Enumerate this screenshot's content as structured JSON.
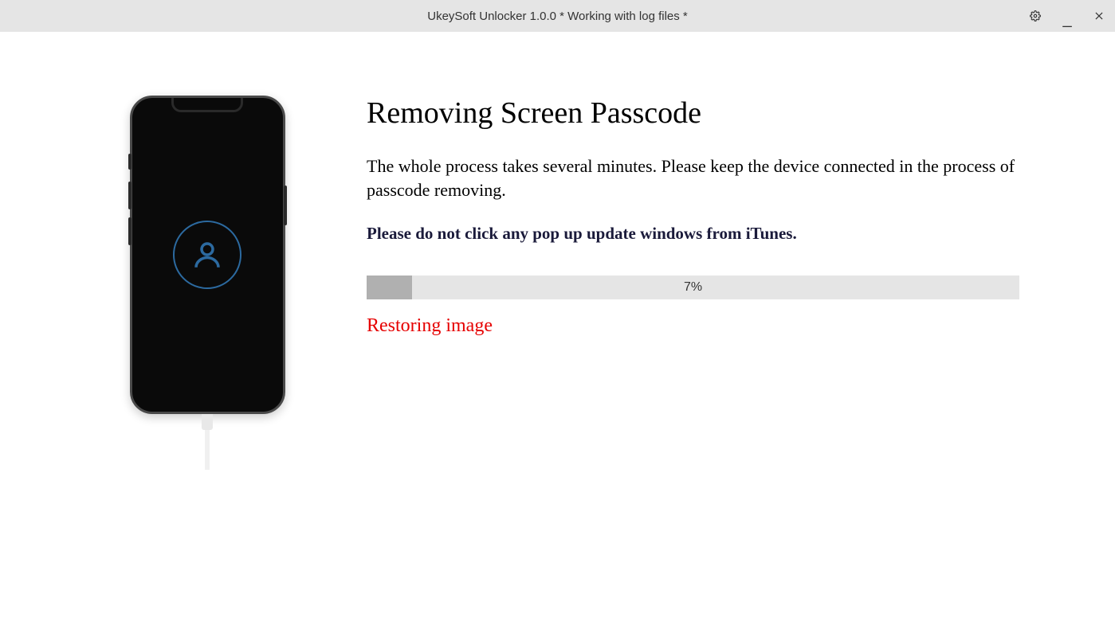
{
  "titlebar": {
    "title": "UkeySoft Unlocker 1.0.0 * Working with log files *"
  },
  "main": {
    "heading": "Removing Screen Passcode",
    "description": "The whole process takes several minutes. Please keep the device connected in the process of passcode removing.",
    "warning": "Please do not click any pop up update windows from iTunes.",
    "progress": {
      "percent": 7,
      "label": "7%",
      "fill_width": "7%"
    },
    "status": "Restoring image"
  },
  "colors": {
    "status_red": "#e60000",
    "accent_blue": "#2c6aa0"
  }
}
